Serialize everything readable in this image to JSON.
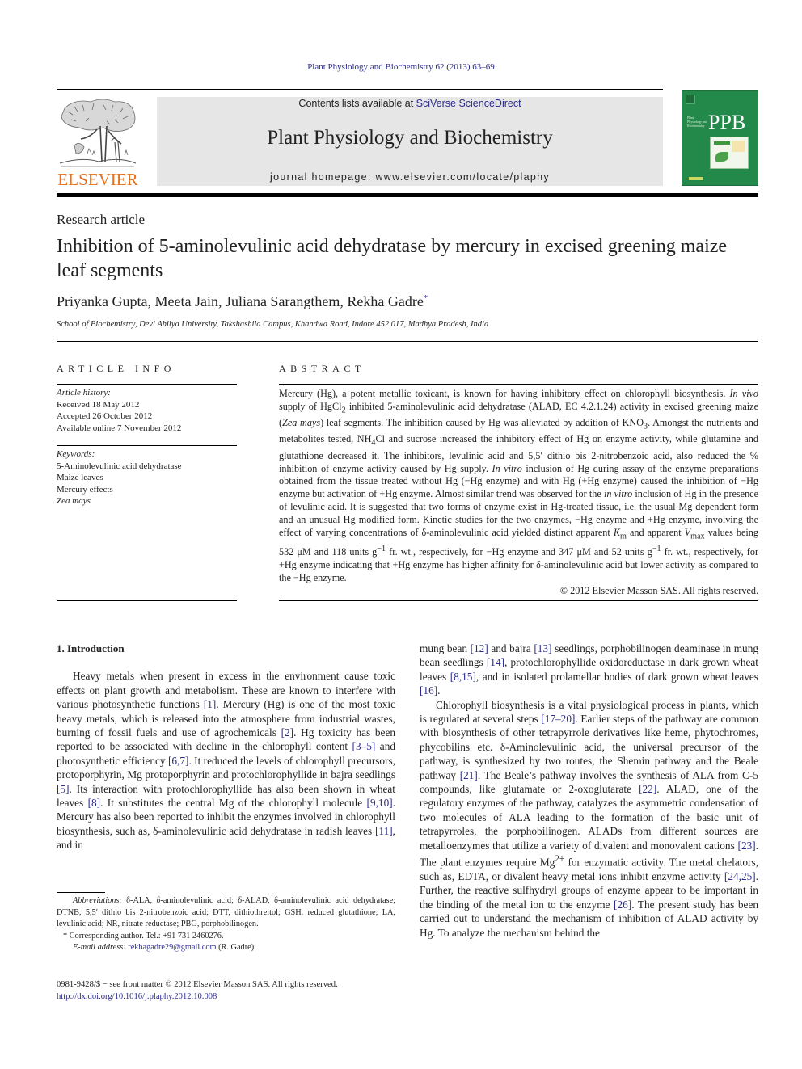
{
  "header": {
    "citation": "Plant Physiology and Biochemistry 62 (2013) 63–69",
    "contents_prefix": "Contents lists available at ",
    "contents_link": "SciVerse ScienceDirect",
    "journal_title": "Plant Physiology and Biochemistry",
    "homepage_prefix": "journal homepage: ",
    "homepage_url": "www.elsevier.com/locate/plaphy",
    "publisher_logo_text": "ELSEVIER",
    "cover_abbrev": "PPB",
    "cover_small_text": "Plant Physiology and Biochemistry",
    "colors": {
      "link": "#2a2a8c",
      "elsevier_orange": "#e8701a",
      "cover_green": "#23894a",
      "banner_gray": "#e6e6e6"
    }
  },
  "article": {
    "type": "Research article",
    "title": "Inhibition of 5-aminolevulinic acid dehydratase by mercury in excised greening maize leaf segments",
    "authors": "Priyanka Gupta, Meeta Jain, Juliana Sarangthem, Rekha Gadre",
    "corresponding_mark": "*",
    "affiliation": "School of Biochemistry, Devi Ahilya University, Takshashila Campus, Khandwa Road, Indore 452 017, Madhya Pradesh, India"
  },
  "article_info": {
    "heading": "ARTICLE INFO",
    "history_label": "Article history:",
    "history": [
      "Received 18 May 2012",
      "Accepted 26 October 2012",
      "Available online 7 November 2012"
    ],
    "keywords_label": "Keywords:",
    "keywords": [
      "5-Aminolevulinic acid dehydratase",
      "Maize leaves",
      "Mercury effects",
      "Zea mays"
    ]
  },
  "abstract": {
    "heading": "ABSTRACT",
    "s1": "Mercury (Hg), a potent metallic toxicant, is known for having inhibitory effect on chlorophyll biosynthesis. ",
    "in_vivo": "In vivo",
    "s2a": " supply of HgCl",
    "sub2": "2",
    "s2b": " inhibited 5-aminolevulinic acid dehydratase (ALAD, EC 4.2.1.24) activity in excised greening maize (",
    "zea": "Zea mays",
    "s3a": ") leaf segments. The inhibition caused by Hg was alleviated by addition of KNO",
    "sub3": "3",
    "s3b": ". Amongst the nutrients and metabolites tested, NH",
    "sub4": "4",
    "s3c": "Cl and sucrose increased the inhibitory effect of Hg on enzyme activity, while glutamine and glutathione decreased it. The inhibitors, levulinic acid and 5,5′ dithio bis 2-nitrobenzoic acid, also reduced the % inhibition of enzyme activity caused by Hg supply. ",
    "in_vitro": "In vitro",
    "s4": " inclusion of Hg during assay of the enzyme preparations obtained from the tissue treated without Hg (−Hg enzyme) and with Hg (+Hg enzyme) caused the inhibition of −Hg enzyme but activation of +Hg enzyme. Almost similar trend was observed for the ",
    "in_vitro2": "in vitro",
    "s5": " inclusion of Hg in the presence of levulinic acid. It is suggested that two forms of enzyme exist in Hg-treated tissue, i.e. the usual Mg dependent form and an unusual Hg modified form. Kinetic studies for the two enzymes, −Hg enzyme and +Hg enzyme, involving the effect of varying concentrations of δ-aminolevulinic acid yielded distinct apparent ",
    "km": "K",
    "km_sub": "m",
    "s6": " and apparent ",
    "vmax": "V",
    "vmax_sub": "max",
    "s7": " values being 532 μM and 118 units g",
    "sup_neg1": "−1",
    "s8": " fr. wt., respectively, for −Hg enzyme and 347 μM and 52 units g",
    "s9": " fr. wt., respectively, for +Hg enzyme indicating that +Hg enzyme has higher affinity for δ-aminolevulinic acid but lower activity as compared to the −Hg enzyme.",
    "copyright": "© 2012 Elsevier Masson SAS. All rights reserved."
  },
  "body": {
    "intro_heading": "1.  Introduction",
    "left": {
      "t1": "Heavy metals when present in excess in the environment cause toxic effects on plant growth and metabolism. These are known to interfere with various photosynthetic functions ",
      "r1": "[1]",
      "t2": ". Mercury (Hg) is one of the most toxic heavy metals, which is released into the atmosphere from industrial wastes, burning of fossil fuels and use of agrochemicals ",
      "r2": "[2]",
      "t3": ". Hg toxicity has been reported to be associated with decline in the chlorophyll content ",
      "r3": "[3–5]",
      "t4": " and photosynthetic efficiency ",
      "r4": "[6,7]",
      "t5": ". It reduced the levels of chlorophyll precursors, protoporphyrin, Mg protoporphyrin and protochlorophyllide in bajra seedlings ",
      "r5": "[5]",
      "t6": ". Its interaction with protochlorophyllide has also been shown in wheat leaves ",
      "r6": "[8]",
      "t7": ". It substitutes the central Mg of the chlorophyll molecule ",
      "r7": "[9,10]",
      "t8": ". Mercury has also been reported to inhibit the enzymes involved in chlorophyll biosynthesis, such as, δ-aminolevulinic acid dehydratase in radish leaves ",
      "r8": "[11]",
      "t9": ", and in"
    },
    "right": {
      "t1": "mung bean ",
      "r1": "[12]",
      "t2": " and bajra ",
      "r2": "[13]",
      "t3": " seedlings, porphobilinogen deaminase in mung bean seedlings ",
      "r3": "[14]",
      "t4": ", protochlorophyllide oxidoreductase in dark grown wheat leaves ",
      "r4": "[8,15]",
      "t5": ", and in isolated prolamellar bodies of dark grown wheat leaves ",
      "r5": "[16]",
      "t6": ".",
      "p2_t1": "Chlorophyll biosynthesis is a vital physiological process in plants, which is regulated at several steps ",
      "p2_r1": "[17–20]",
      "p2_t2": ". Earlier steps of the pathway are common with biosynthesis of other tetrapyrrole derivatives like heme, phytochromes, phycobilins etc. δ-Aminolevulinic acid, the universal precursor of the pathway, is synthesized by two routes, the Shemin pathway and the Beale pathway ",
      "p2_r2": "[21]",
      "p2_t3": ". The Beale’s pathway involves the synthesis of ALA from C-5 compounds, like glutamate or 2-oxoglutarate ",
      "p2_r3": "[22]",
      "p2_t4": ". ALAD, one of the regulatory enzymes of the pathway, catalyzes the asymmetric condensation of two molecules of ALA leading to the formation of the basic unit of tetrapyrroles, the porphobilinogen. ALADs from different sources are metalloenzymes that utilize a variety of divalent and monovalent cations ",
      "p2_r4": "[23]",
      "p2_t5": ". The plant enzymes require Mg",
      "p2_sup": "2+",
      "p2_t6": " for enzymatic activity. The metal chelators, such as, EDTA, or divalent heavy metal ions inhibit enzyme activity ",
      "p2_r5": "[24,25]",
      "p2_t7": ". Further, the reactive sulfhydryl groups of enzyme appear to be important in the binding of the metal ion to the enzyme ",
      "p2_r6": "[26]",
      "p2_t8": ". The present study has been carried out to understand the mechanism of inhibition of ALAD activity by Hg. To analyze the mechanism behind the"
    }
  },
  "footnotes": {
    "abbr_label": "Abbreviations:",
    "abbr_text": " δ-ALA, δ-aminolevulinic acid; δ-ALAD, δ-aminolevulinic acid dehydratase; DTNB, 5,5′ dithio bis 2-nitrobenzoic acid; DTT, dithiothreitol; GSH, reduced glutathione; LA, levulinic acid; NR, nitrate reductase; PBG, porphobilinogen.",
    "corr": "* Corresponding author. Tel.: +91 731 2460276.",
    "email_label": "E-mail address:",
    "email": "rekhagadre29@gmail.com",
    "email_suffix": " (R. Gadre).",
    "front_matter": "0981-9428/$ − see front matter © 2012 Elsevier Masson SAS. All rights reserved.",
    "doi": "http://dx.doi.org/10.1016/j.plaphy.2012.10.008"
  }
}
